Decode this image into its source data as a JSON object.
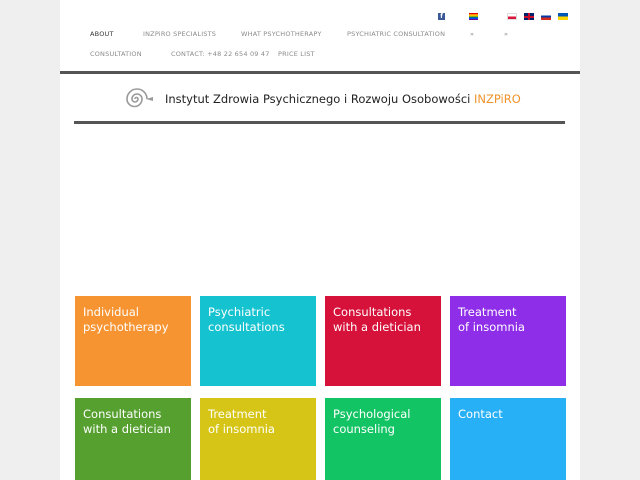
{
  "nav": {
    "row1": [
      "ABOUT",
      "INZPiRO SPECIALISTS",
      "WHAT PSYCHOTHERAPY",
      "PSYCHIATRIC CONSULTATION",
      "»",
      "»"
    ],
    "row2": [
      "CONSULTATION",
      "CONTACT: +48 22 654 09 47",
      "PRICE LIST"
    ]
  },
  "flags": {
    "facebook": "f",
    "items": [
      "rainbow-flag",
      "polish-flag",
      "english-flag",
      "russian-flag",
      "ukrainian-flag"
    ]
  },
  "header": {
    "title": "Instytut Zdrowia Psychicznego i Rozwoju Osobowości",
    "brand": "INZPiRO",
    "brand_color": "#f0932b"
  },
  "tiles": [
    {
      "label": "Individual\npsychotherapy",
      "color": "#f79432"
    },
    {
      "label": "Psychiatric\nconsultations",
      "color": "#15c2cf"
    },
    {
      "label": "Consultations\nwith a dietician",
      "color": "#d6113a"
    },
    {
      "label": "Treatment\nof insomnia",
      "color": "#8e2ee8"
    },
    {
      "label": "Consultations\nwith a dietician",
      "color": "#56a030"
    },
    {
      "label": "Treatment\nof insomnia",
      "color": "#d6c516"
    },
    {
      "label": "Psychological\ncounseling",
      "color": "#13c464"
    },
    {
      "label": "Contact",
      "color": "#27b0f5"
    }
  ]
}
